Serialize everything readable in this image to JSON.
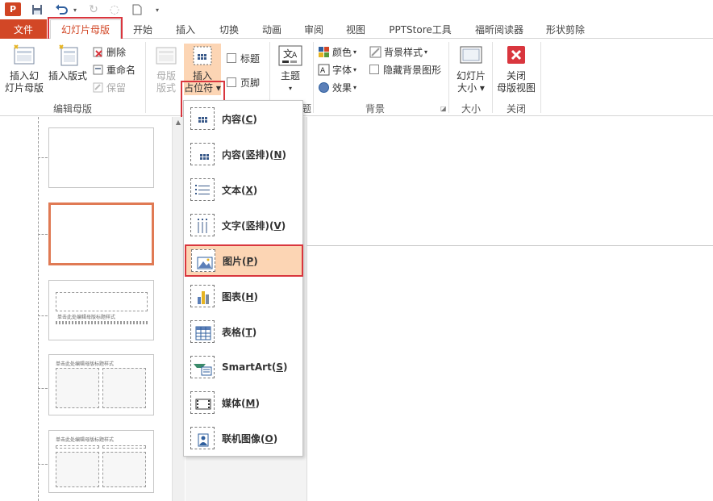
{
  "qat": {
    "logo": "P",
    "undo_icon": "undo-icon",
    "redo_icon": "redo-icon",
    "new_icon": "new-file-icon"
  },
  "tabs": [
    {
      "label": "文件"
    },
    {
      "label": "幻灯片母版"
    },
    {
      "label": "开始"
    },
    {
      "label": "插入"
    },
    {
      "label": "切换"
    },
    {
      "label": "动画"
    },
    {
      "label": "审阅"
    },
    {
      "label": "视图"
    },
    {
      "label": "PPTStore工具"
    },
    {
      "label": "福昕阅读器"
    },
    {
      "label": "形状剪除"
    }
  ],
  "ribbon": {
    "edit_master": {
      "insert_slide_master_line1": "插入幻",
      "insert_slide_master_line2": "灯片母版",
      "insert_layout": "插入版式",
      "delete": "删除",
      "rename": "重命名",
      "preserve": "保留",
      "group_label": "编辑母版"
    },
    "master_layout": {
      "master_layout_line1": "母版",
      "master_layout_line2": "版式",
      "insert_placeholder_line1": "插入",
      "insert_placeholder_line2": "占位符",
      "title_checkbox": "标题",
      "footer_checkbox": "页脚"
    },
    "edit_theme": {
      "theme_label": "主题",
      "group_label_tail": "题"
    },
    "background": {
      "colors": "颜色",
      "fonts": "字体",
      "effects": "效果",
      "background_styles": "背景样式",
      "hide_background": "隐藏背景图形",
      "group_label": "背景"
    },
    "size": {
      "slide_size_line1": "幻灯片",
      "slide_size_line2": "大小",
      "group_label": "大小"
    },
    "close": {
      "close_line1": "关闭",
      "close_line2": "母版视图",
      "group_label": "关闭"
    }
  },
  "dropdown": {
    "items": [
      {
        "label": "内容(",
        "key": "C",
        "tail": ")"
      },
      {
        "label": "内容(竖排)(",
        "key": "N",
        "tail": ")"
      },
      {
        "label": "文本(",
        "key": "X",
        "tail": ")"
      },
      {
        "label": "文字(竖排)(",
        "key": "V",
        "tail": ")"
      },
      {
        "label": "图片(",
        "key": "P",
        "tail": ")"
      },
      {
        "label": "图表(",
        "key": "H",
        "tail": ")"
      },
      {
        "label": "表格(",
        "key": "T",
        "tail": ")"
      },
      {
        "label": "SmartArt(",
        "key": "S",
        "tail": ")"
      },
      {
        "label": "媒体(",
        "key": "M",
        "tail": ")"
      },
      {
        "label": "联机图像(",
        "key": "O",
        "tail": ")"
      }
    ]
  },
  "thumbnails": {
    "thumb3_title": "单击此处编辑母版标题样式",
    "thumb4_title": "单击此处编辑母版标题样式",
    "thumb5_title": "单击此处编辑母版标题样式"
  },
  "colors": {
    "accent": "#d24726",
    "highlight_box": "#d9363e",
    "selection_fill": "#fcd5b4"
  }
}
